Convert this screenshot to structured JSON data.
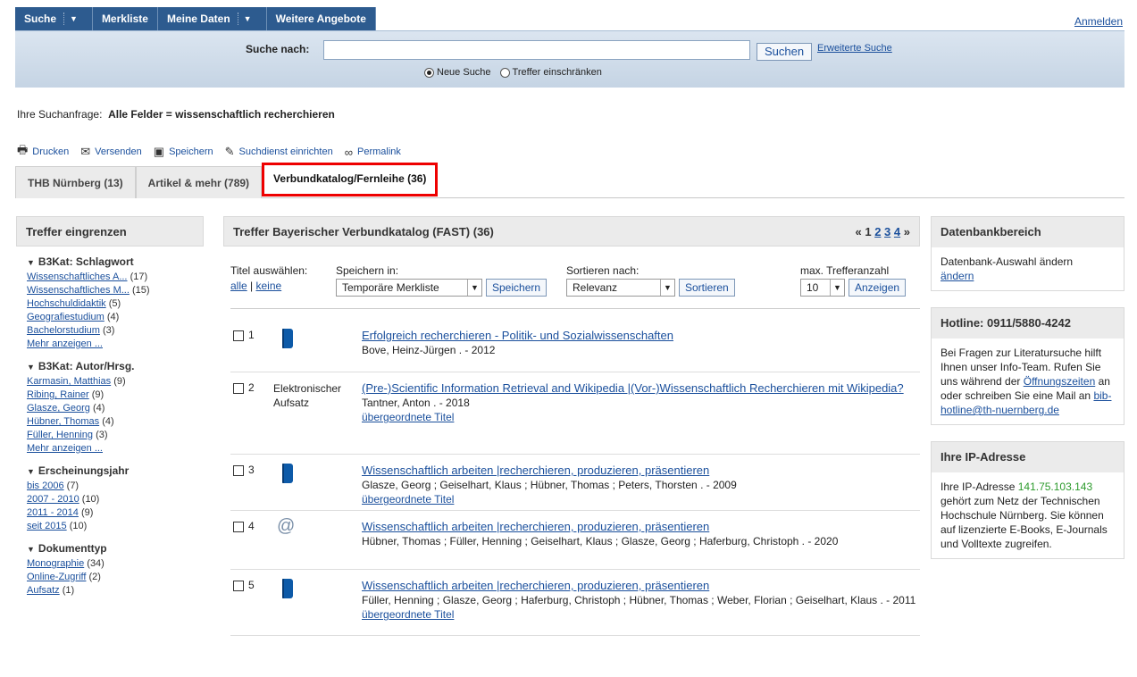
{
  "nav": {
    "items": [
      "Suche",
      "Merkliste",
      "Meine Daten",
      "Weitere Angebote"
    ],
    "login": "Anmelden"
  },
  "search": {
    "label": "Suche nach:",
    "value": "",
    "button": "Suchen",
    "advanced": "Erweiterte Suche",
    "radio_new": "Neue Suche",
    "radio_refine": "Treffer einschränken"
  },
  "query": {
    "label": "Ihre Suchanfrage:",
    "value": "Alle Felder = wissenschaftlich recherchieren"
  },
  "tools": [
    "Drucken",
    "Versenden",
    "Speichern",
    "Suchdienst einrichten",
    "Permalink"
  ],
  "tabs": [
    "THB Nürnberg (13)",
    "Artikel & mehr (789)",
    "Verbundkatalog/Fernleihe (36)"
  ],
  "left": {
    "title": "Treffer eingrenzen",
    "facets": [
      {
        "title": "B3Kat: Schlagwort",
        "items": [
          {
            "label": "Wissenschaftliches A...",
            "count": "(17)"
          },
          {
            "label": "Wissenschaftliches M...",
            "count": "(15)"
          },
          {
            "label": "Hochschuldidaktik",
            "count": "(5)"
          },
          {
            "label": "Geografiestudium",
            "count": "(4)"
          },
          {
            "label": "Bachelorstudium",
            "count": "(3)"
          },
          {
            "label": "Mehr anzeigen ...",
            "count": ""
          }
        ]
      },
      {
        "title": "B3Kat: Autor/Hrsg.",
        "items": [
          {
            "label": "Karmasin, Matthias",
            "count": "(9)"
          },
          {
            "label": "Ribing, Rainer",
            "count": "(9)"
          },
          {
            "label": "Glasze, Georg",
            "count": "(4)"
          },
          {
            "label": "Hübner, Thomas",
            "count": "(4)"
          },
          {
            "label": "Füller, Henning",
            "count": "(3)"
          },
          {
            "label": "Mehr anzeigen ...",
            "count": ""
          }
        ]
      },
      {
        "title": "Erscheinungsjahr",
        "items": [
          {
            "label": "bis 2006",
            "count": "(7)"
          },
          {
            "label": "2007 - 2010",
            "count": "(10)"
          },
          {
            "label": "2011 - 2014",
            "count": "(9)"
          },
          {
            "label": "seit 2015",
            "count": "(10)"
          }
        ]
      },
      {
        "title": "Dokumenttyp",
        "items": [
          {
            "label": "Monographie",
            "count": "(34)"
          },
          {
            "label": "Online-Zugriff",
            "count": "(2)"
          },
          {
            "label": "Aufsatz",
            "count": "(1)"
          }
        ]
      }
    ]
  },
  "center": {
    "title": "Treffer Bayerischer Verbundkatalog (FAST) (36)",
    "pages": {
      "prev": "«",
      "current": "1",
      "others": [
        "2",
        "3",
        "4"
      ],
      "next": "»"
    },
    "select_label": "Titel auswählen:",
    "select_all": "alle",
    "select_none": "keine",
    "save_label": "Speichern in:",
    "save_value": "Temporäre Merkliste",
    "save_button": "Speichern",
    "sort_label": "Sortieren nach:",
    "sort_value": "Relevanz",
    "sort_button": "Sortieren",
    "max_label": "max. Trefferanzahl",
    "max_value": "10",
    "max_button": "Anzeigen",
    "results": [
      {
        "num": "1",
        "type": "",
        "icon": "book-icon",
        "title": "Erfolgreich recherchieren - Politik- und Sozialwissenschaften",
        "meta": "Bove, Heinz-Jürgen . - 2012",
        "extra": ""
      },
      {
        "num": "2",
        "type": "Elektronischer Aufsatz",
        "icon": "",
        "title": "(Pre-)Scientific Information Retrieval and Wikipedia |(Vor-)Wissenschaftlich Recherchieren mit Wikipedia?",
        "meta": "Tantner, Anton . - 2018",
        "extra": "übergeordnete Titel"
      },
      {
        "num": "3",
        "type": "",
        "icon": "book-icon",
        "title": "Wissenschaftlich arbeiten |recherchieren, produzieren, präsentieren",
        "meta": "Glasze, Georg ; Geiselhart, Klaus ; Hübner, Thomas ; Peters, Thorsten . - 2009",
        "extra": "übergeordnete Titel"
      },
      {
        "num": "4",
        "type": "",
        "icon": "ebook-icon",
        "title": "Wissenschaftlich arbeiten |recherchieren, produzieren, präsentieren",
        "meta": "Hübner, Thomas ; Füller, Henning ; Geiselhart, Klaus ; Glasze, Georg ; Haferburg, Christoph . - 2020",
        "extra": ""
      },
      {
        "num": "5",
        "type": "",
        "icon": "book-icon",
        "title": "Wissenschaftlich arbeiten |recherchieren, produzieren, präsentieren",
        "meta": "Füller, Henning ; Glasze, Georg ; Haferburg, Christoph ; Hübner, Thomas ; Weber, Florian ; Geiselhart, Klaus . - 2011",
        "extra": "übergeordnete Titel"
      }
    ]
  },
  "right": {
    "db_title": "Datenbankbereich",
    "db_text": "Datenbank-Auswahl ändern",
    "db_link": "ändern",
    "hotline_title": "Hotline: 0911/5880-4242",
    "hotline_text1": "Bei Fragen zur Literatursuche hilft Ihnen unser Info-Team. Rufen Sie uns während der",
    "hotline_link1": "Öffnungszeiten",
    "hotline_text2": "an oder schreiben Sie eine Mail an",
    "hotline_link2": "bib-hotline@th-nuernberg.de",
    "ip_title": "Ihre IP-Adresse",
    "ip_text1": "Ihre IP-Adresse",
    "ip_value": "141.75.103.143",
    "ip_text2": "gehört zum Netz der Technischen Hochschule Nürnberg. Sie können auf lizenzierte E-Books, E-Journals und Volltexte zugreifen."
  }
}
